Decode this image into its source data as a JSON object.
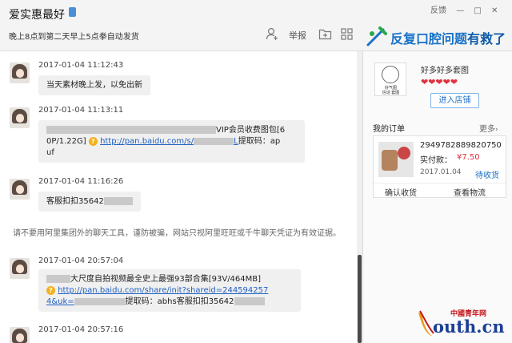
{
  "header": {
    "shop_name": "爱实惠最好",
    "notice": "晚上8点到第二天早上5点拳自动发货",
    "report_label": "举报",
    "window_controls": [
      "反馈",
      "—",
      "□",
      "✕"
    ]
  },
  "promo_banner": {
    "text_part1": "反复口腔问题",
    "text_part2": "有救了"
  },
  "messages": [
    {
      "time": "2017-01-04 11:12:43",
      "text": "当天素材晚上发，以免出新"
    },
    {
      "time": "2017-01-04 11:13:11",
      "line1_text": "VIP会员收费图包[6",
      "line2_pre": "0P/1.22G]",
      "link_pre": "http://pan.baidu.com/s/",
      "link_post": "L",
      "pass_label": "提取码：ap",
      "line3": "uf"
    },
    {
      "time": "2017-01-04 11:16:26",
      "text": "客服扣扣35642"
    },
    {
      "time": "2017-01-04 20:57:04",
      "line1_text": "大尺度自拍视频最全史上最强93部合集[93V/464MB]",
      "link1": "http://pan.baidu.com/share/init?shareid=244594257",
      "link2": "4&uk=",
      "tail": "提取码：abhs客服扣扣35642"
    },
    {
      "time": "2017-01-04 20:57:16"
    }
  ],
  "system_notice": "请不要用阿里集团外的聊天工具，谨防被骗，网站只视阿里旺旺或千牛聊天凭证为有效证据。",
  "shop_card": {
    "title": "好多好多套图",
    "hearts": "❤❤❤❤❤",
    "enter_label": "进入店铺"
  },
  "orders": {
    "header": "我的订单",
    "more": "更多",
    "item": {
      "order_id": "2949782889820750",
      "paid_label": "实付款：",
      "price": "¥7.50",
      "date": "2017.01.04",
      "status": "待收货",
      "confirm": "确认收货",
      "logistics": "查看物流"
    }
  },
  "watermark": {
    "top": "中國青年网",
    "main": "outh.cn"
  }
}
